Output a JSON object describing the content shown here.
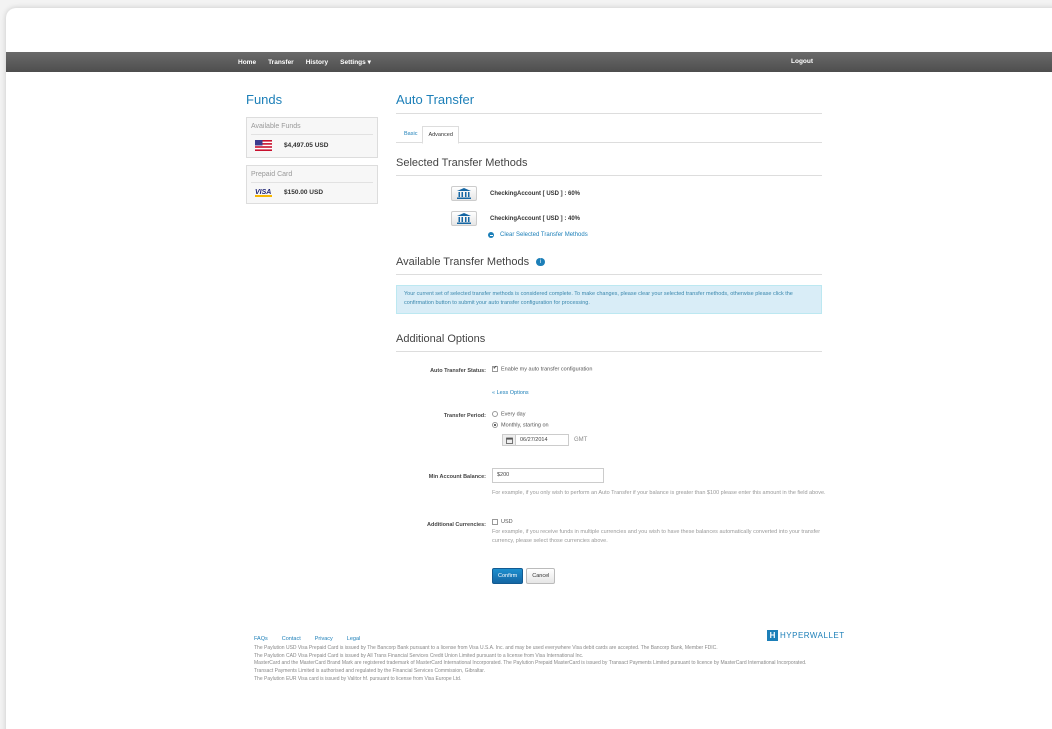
{
  "nav": {
    "home": "Home",
    "transfer": "Transfer",
    "history": "History",
    "settings": "Settings ▾",
    "logout": "Logout"
  },
  "sidebar": {
    "title": "Funds",
    "available": {
      "title": "Available Funds",
      "amount": "$4,497.05 USD"
    },
    "prepaid": {
      "title": "Prepaid Card",
      "amount": "$150.00 USD",
      "card_brand": "VISA"
    }
  },
  "main": {
    "title": "Auto Transfer",
    "tabs": [
      {
        "label": "Basic"
      },
      {
        "label": "Advanced"
      }
    ],
    "selected_title": "Selected Transfer Methods",
    "methods": [
      {
        "label": "CheckingAccount [ USD ] : 60%"
      },
      {
        "label": "CheckingAccount [ USD ] : 40%"
      }
    ],
    "clear_link": "Clear Selected Transfer Methods",
    "available_title": "Available Transfer Methods",
    "info_badge": "i",
    "info_text": "Your current set of selected transfer methods is considered complete. To make changes, please clear your selected transfer methods, otherwise please click the confirmation button to submit your auto transfer configuration for processing.",
    "options_title": "Additional Options"
  },
  "form": {
    "status_label": "Auto Transfer Status:",
    "status_checkbox": "Enable my auto transfer configuration",
    "less_options": "« Less Options",
    "period_label": "Transfer Period:",
    "period_every_day": "Every day",
    "period_monthly": "Monthly, starting on",
    "date_value": "06/27/2014",
    "gmt": "GMT",
    "min_balance_label": "Min Account Balance:",
    "min_balance_value": "$200",
    "min_balance_help": "For example, if you only wish to perform an Auto Transfer if your balance is greater than $100 please enter this amount in the field above.",
    "currencies_label": "Additional Currencies:",
    "currency_usd": "USD",
    "currencies_help": "For example, if you receive funds in multiple currencies and you wish to have these balances automatically converted into your transfer currency, please select those currencies above.",
    "confirm": "Confirm",
    "cancel": "Cancel"
  },
  "footer": {
    "links": [
      "FAQs",
      "Contact",
      "Privacy",
      "Legal"
    ],
    "logo_text": "HYPERWALLET",
    "logo_mark": "H",
    "lines": [
      "The Paylution USD Visa Prepaid Card is issued by The Bancorp Bank pursuant to a license from Visa U.S.A. Inc. and may be used everywhere Visa debit cards are accepted. The Bancorp Bank, Member FDIC.",
      "The Paylution CAD Visa Prepaid Card is issued by All Trans Financial Services Credit Union Limited pursuant to a license from Visa International Inc.",
      "MasterCard and the MasterCard Brand Mark are registered trademark of MasterCard International Incorporated. The Paylution Prepaid MasterCard is issued by Transact Payments Limited pursuant to licence by MasterCard International Incorporated. Transact Payments Limited is authorised and regulated by the Financial Services Commission, Gibraltar.",
      "The Paylution EUR Visa card is issued by Valitor hf. pursuant to license from Visa Europe Ltd."
    ]
  },
  "colors": {
    "accent": "#1c7fb8",
    "navbar": "#5a5a5a",
    "info_bg": "#d9edf7"
  }
}
